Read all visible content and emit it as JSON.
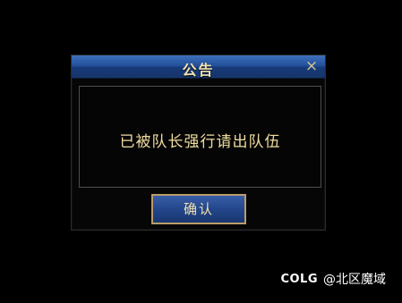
{
  "dialog": {
    "title": "公告",
    "close_symbol": "×",
    "message": "已被队长强行请出队伍",
    "confirm_label": "确认"
  },
  "watermark": {
    "logo": "COLG",
    "source": "@北区魔域"
  },
  "colors": {
    "background": "#000000",
    "title_bar": "#23519a",
    "gold_text": "#f0dd9f",
    "button_border": "#b99c6a"
  }
}
